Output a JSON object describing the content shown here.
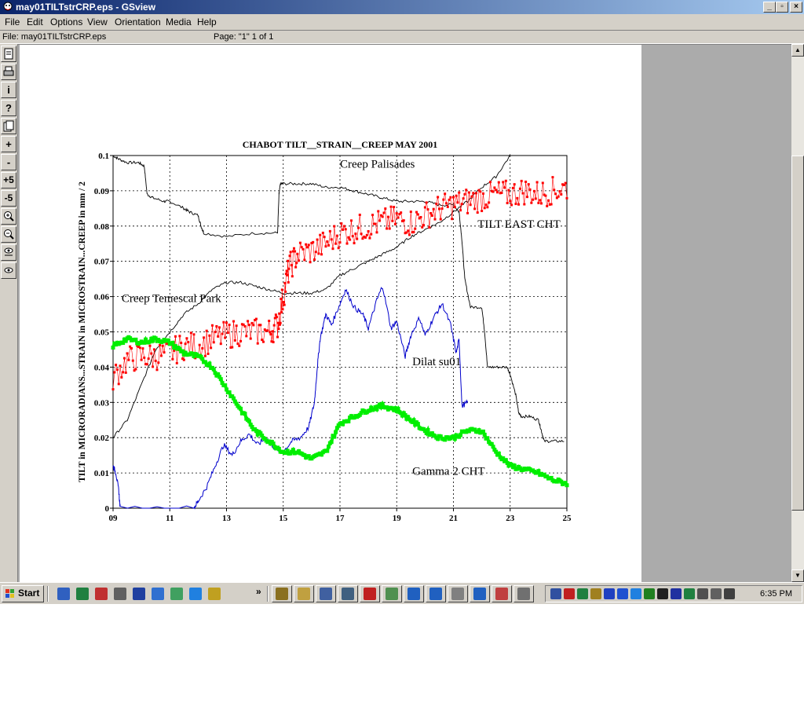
{
  "window": {
    "title": "may01TILTstrCRP.eps - GSview"
  },
  "menu": [
    "File",
    "Edit",
    "Options",
    "View",
    "Orientation",
    "Media",
    "Help"
  ],
  "status": {
    "file": "File: may01TILTstrCRP.eps",
    "page": "Page: \"1\"  1 of 1"
  },
  "toolbar": {
    "zoom_in": "+",
    "zoom_out": "-",
    "plus5": "+5",
    "minus5": "-5",
    "info": "i",
    "help": "?"
  },
  "taskbar": {
    "start": "Start",
    "clock": "6:35 PM",
    "chevron": "»"
  },
  "icons": {
    "title": "gsview-icon",
    "min": "minimize-icon",
    "max": "maximize-icon",
    "close": "close-icon"
  },
  "chart_data": {
    "type": "line",
    "title": "CHABOT TILT__STRAIN__CREEP    MAY 2001",
    "ylabel": "TILT in MICRORADIANS...STRAIN in MICROSTRAIN...CREEP in mm / 2",
    "xlabel": "",
    "xlim": [
      9,
      25
    ],
    "ylim": [
      0,
      0.1
    ],
    "x_ticks": [
      "09",
      "11",
      "13",
      "15",
      "17",
      "19",
      "21",
      "23",
      "25"
    ],
    "y_ticks": [
      "0",
      "0.01",
      "0.02",
      "0.03",
      "0.04",
      "0.05",
      "0.06",
      "0.07",
      "0.08",
      "0.09",
      "0.1"
    ],
    "grid": true,
    "annotations": [
      "Creep Palisades",
      "TILT EAST CHT",
      "Creep Temescal Park",
      "Dilat su01",
      "Gamma 2 CHT"
    ],
    "series": [
      {
        "name": "Creep Palisades",
        "color": "#000000",
        "style": "line",
        "x": [
          9.0,
          9.2,
          9.5,
          9.9,
          10.1,
          10.2,
          10.4,
          10.8,
          11.0,
          11.5,
          11.7,
          12.0,
          12.1,
          12.2,
          13.0,
          14.0,
          14.8,
          14.85,
          14.9,
          15.0,
          15.5,
          16.0,
          16.5,
          17.0,
          17.5,
          18.0,
          18.5,
          19.0,
          19.5,
          20.0,
          20.5,
          21.0,
          21.2,
          21.3,
          21.4,
          21.6,
          22.0,
          22.1,
          22.2,
          22.5,
          22.9,
          23.0,
          23.2,
          23.3,
          23.4,
          23.7,
          24.0,
          24.1,
          24.2,
          24.5,
          24.9
        ],
        "y": [
          0.1,
          0.099,
          0.098,
          0.098,
          0.097,
          0.089,
          0.088,
          0.087,
          0.087,
          0.085,
          0.084,
          0.083,
          0.08,
          0.078,
          0.077,
          0.078,
          0.078,
          0.089,
          0.092,
          0.092,
          0.092,
          0.092,
          0.091,
          0.091,
          0.09,
          0.089,
          0.088,
          0.087,
          0.087,
          0.087,
          0.086,
          0.086,
          0.084,
          0.076,
          0.065,
          0.057,
          0.057,
          0.05,
          0.04,
          0.04,
          0.04,
          0.038,
          0.032,
          0.027,
          0.026,
          0.026,
          0.025,
          0.022,
          0.019,
          0.019,
          0.019
        ]
      },
      {
        "name": "Creep Temescal Park",
        "color": "#000000",
        "style": "line",
        "x": [
          9.0,
          9.5,
          10.0,
          10.5,
          11.0,
          11.5,
          12.0,
          12.5,
          13.0,
          13.5,
          14.0,
          14.5,
          15.0,
          15.5,
          16.0,
          16.5,
          17.0,
          17.5,
          18.0,
          18.5,
          19.0,
          19.5,
          20.0,
          20.5,
          21.0,
          21.5,
          22.0,
          22.5,
          23.0
        ],
        "y": [
          0.02,
          0.025,
          0.035,
          0.045,
          0.05,
          0.055,
          0.058,
          0.062,
          0.064,
          0.064,
          0.063,
          0.062,
          0.061,
          0.061,
          0.061,
          0.062,
          0.066,
          0.068,
          0.07,
          0.072,
          0.074,
          0.077,
          0.079,
          0.081,
          0.084,
          0.087,
          0.091,
          0.094,
          0.1
        ]
      },
      {
        "name": "TILT EAST CHT",
        "color": "#ff0000",
        "style": "dotted-markers",
        "x": [
          9.0,
          9.5,
          10.0,
          10.5,
          11.0,
          11.5,
          12.0,
          12.5,
          13.0,
          13.5,
          14.0,
          14.5,
          14.8,
          15.0,
          15.2,
          15.5,
          16.0,
          16.5,
          17.0,
          17.5,
          18.0,
          18.5,
          19.0,
          19.5,
          20.0,
          20.5,
          21.0,
          21.5,
          22.0,
          22.5,
          23.0,
          23.5,
          24.0,
          24.5,
          25.0
        ],
        "y": [
          0.037,
          0.042,
          0.043,
          0.043,
          0.044,
          0.046,
          0.046,
          0.048,
          0.049,
          0.05,
          0.05,
          0.05,
          0.052,
          0.06,
          0.068,
          0.072,
          0.073,
          0.075,
          0.078,
          0.079,
          0.08,
          0.081,
          0.082,
          0.081,
          0.083,
          0.085,
          0.086,
          0.087,
          0.088,
          0.089,
          0.089,
          0.09,
          0.089,
          0.09,
          0.091
        ]
      },
      {
        "name": "Dilat su01",
        "color": "#0000cc",
        "style": "line",
        "x": [
          9.0,
          9.1,
          9.2,
          9.25,
          11.85,
          12.0,
          12.3,
          12.6,
          12.9,
          13.2,
          13.5,
          13.8,
          14.1,
          14.4,
          14.7,
          15.0,
          15.3,
          15.6,
          15.9,
          16.1,
          16.2,
          16.3,
          16.5,
          16.7,
          17.0,
          17.2,
          17.5,
          17.8,
          18.0,
          18.3,
          18.5,
          18.8,
          19.0,
          19.3,
          19.5,
          19.8,
          20.0,
          20.3,
          20.6,
          20.9,
          21.1,
          21.2,
          21.3,
          21.5
        ],
        "y": [
          0.012,
          0.01,
          0.005,
          0.0,
          0.0,
          0.002,
          0.006,
          0.012,
          0.018,
          0.015,
          0.019,
          0.021,
          0.018,
          0.02,
          0.017,
          0.016,
          0.019,
          0.02,
          0.023,
          0.03,
          0.04,
          0.048,
          0.055,
          0.052,
          0.058,
          0.062,
          0.057,
          0.055,
          0.051,
          0.059,
          0.063,
          0.051,
          0.053,
          0.043,
          0.049,
          0.054,
          0.049,
          0.054,
          0.058,
          0.052,
          0.044,
          0.048,
          0.029,
          0.03
        ]
      },
      {
        "name": "Gamma 2 CHT",
        "color": "#00ee00",
        "style": "thick-markers",
        "x": [
          9.0,
          9.5,
          10.0,
          10.5,
          11.0,
          11.5,
          12.0,
          12.5,
          13.0,
          13.5,
          14.0,
          14.5,
          15.0,
          15.5,
          16.0,
          16.5,
          17.0,
          17.5,
          18.0,
          18.5,
          19.0,
          19.5,
          20.0,
          20.5,
          21.0,
          21.5,
          22.0,
          22.5,
          23.0,
          23.5,
          24.0,
          24.5,
          25.0
        ],
        "y": [
          0.046,
          0.048,
          0.047,
          0.048,
          0.047,
          0.044,
          0.043,
          0.04,
          0.034,
          0.028,
          0.022,
          0.019,
          0.016,
          0.016,
          0.014,
          0.016,
          0.024,
          0.026,
          0.028,
          0.029,
          0.028,
          0.025,
          0.022,
          0.02,
          0.02,
          0.022,
          0.022,
          0.016,
          0.012,
          0.011,
          0.01,
          0.008,
          0.007
        ]
      }
    ]
  }
}
